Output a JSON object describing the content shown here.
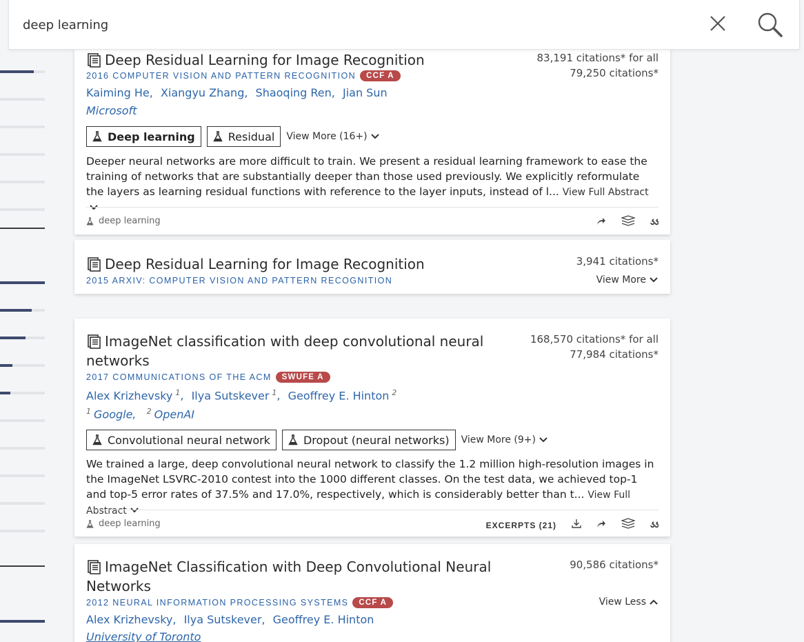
{
  "search": {
    "query": "deep learning"
  },
  "results": [
    {
      "title": "Deep Residual Learning for Image Recognition",
      "venue": "2016 COMPUTER VISION AND PATTERN RECOGNITION",
      "badge": "CCF A",
      "authors": [
        "Kaiming He",
        "Xiangyu Zhang",
        "Shaoqing Ren",
        "Jian Sun"
      ],
      "affiliation": "Microsoft",
      "citations_all": "83,191 citations* for all",
      "citations": "79,250 citations*",
      "tags": [
        "Deep learning",
        "Residual"
      ],
      "view_more": "View More (16+)",
      "abstract": "Deeper neural networks are more difficult to train. We present a residual learning framework to ease the training of networks that are substantially deeper than those used previously. We explicitly reformulate the layers as learning residual functions with reference to the layer inputs, instead of l...",
      "view_full": "View Full Abstract",
      "topic": "deep learning"
    },
    {
      "title": "Deep Residual Learning for Image Recognition",
      "venue": "2015 ARXIV: COMPUTER VISION AND PATTERN RECOGNITION",
      "citations": "3,941 citations*",
      "view_more": "View More"
    },
    {
      "title_line1": "ImageNet classification with deep convolutional neural",
      "title_line2": "networks",
      "venue": "2017 COMMUNICATIONS OF THE ACM",
      "badge": "SWUFE A",
      "authors": [
        "Alex Krizhevsky",
        "Ilya Sutskever",
        "Geoffrey E. Hinton"
      ],
      "author_sups": [
        "1",
        "1",
        "2"
      ],
      "affiliations": [
        "Google",
        "OpenAI"
      ],
      "affiliation_sups": [
        "1",
        "2"
      ],
      "citations_all": "168,570 citations* for all",
      "citations": "77,984 citations*",
      "tags": [
        "Convolutional neural network",
        "Dropout (neural networks)"
      ],
      "view_more": "View More (9+)",
      "abstract": "We trained a large, deep convolutional neural network to classify the 1.2 million high-resolution images in the ImageNet LSVRC-2010 contest into the 1000 different classes. On the test data, we achieved top-1 and top-5 error rates of 37.5% and 17.0%, respectively, which is considerably better than t...",
      "view_full": "View Full Abstract",
      "topic": "deep learning",
      "excerpts": "EXCERPTS (21)"
    },
    {
      "title_line1": "ImageNet Classification with Deep Convolutional Neural",
      "title_line2": "Networks",
      "venue": "2012 NEURAL INFORMATION PROCESSING SYSTEMS",
      "badge": "CCF A",
      "authors": [
        "Alex Krizhevsky",
        "Ilya Sutskever",
        "Geoffrey E. Hinton"
      ],
      "affiliation": "University of Toronto",
      "citations": "90,586 citations*",
      "view_less": "View Less"
    }
  ],
  "sidebar": {
    "facet_levels": [
      0.75,
      0,
      0,
      0,
      0,
      0,
      1.0,
      0.7,
      0.57,
      0.28,
      0.22,
      0,
      0,
      0,
      0,
      0,
      0,
      1.0
    ]
  },
  "colors": {
    "link": "#2d66aa",
    "badge": "#b84a4a",
    "facet": "#3e4a6e"
  }
}
